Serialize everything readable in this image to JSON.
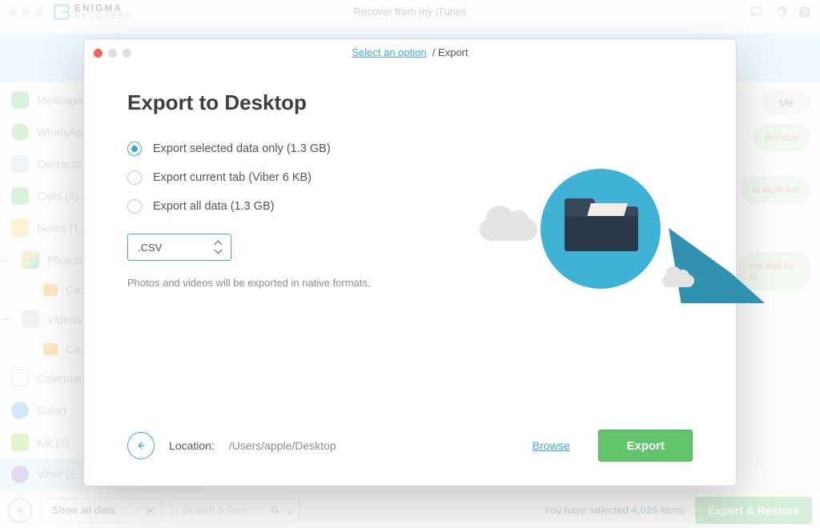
{
  "app": {
    "brand_line1": "ENIGMA",
    "brand_line2": "RECOVERY",
    "window_title": "Recover from my iTunes"
  },
  "sidebar": {
    "items": [
      {
        "label": "Messages",
        "color": "#6FCB6D"
      },
      {
        "label": "WhatsApp",
        "color": "#74D06D"
      },
      {
        "label": "Contacts",
        "color": "#C9D6E2"
      },
      {
        "label": "Calls (2)",
        "color": "#6FCB6D"
      },
      {
        "label": "Notes (1…",
        "color": "#F8CB52"
      },
      {
        "label": "Photos",
        "color": "#F18C8C",
        "sub": "Ca…"
      },
      {
        "label": "Videos",
        "color": "#B6B6B6",
        "sub": "Ca…"
      },
      {
        "label": "Calendar",
        "color": "#EE786E"
      },
      {
        "label": "Safari",
        "color": "#4BA6E3"
      },
      {
        "label": "Kik (2)",
        "color": "#91D043"
      },
      {
        "label": "Viber (1…",
        "color": "#8C6DCF"
      }
    ]
  },
  "me_tab": "Me",
  "bubbles": [
    "birthday",
    "to work eat",
    "my dad ay to"
  ],
  "bottom": {
    "filter": "Show all data",
    "search_placeholder": "Search & filter",
    "selected_prefix": "You have selected ",
    "selected_count": "4,025",
    "selected_suffix": " items",
    "export_restore": "Export & Restore"
  },
  "modal": {
    "crumb_prev": "Select an option",
    "crumb_cur": "Export",
    "title": "Export to Desktop",
    "opts": [
      "Export selected data only (1.3 GB)",
      "Export current tab (Viber 6 KB)",
      "Export all data (1.3 GB)"
    ],
    "format": ".CSV",
    "note": "Photos and videos will be exported in native formats.",
    "location_label": "Location:",
    "location_path": "/Users/apple/Desktop",
    "browse": "Browse",
    "export": "Export"
  }
}
